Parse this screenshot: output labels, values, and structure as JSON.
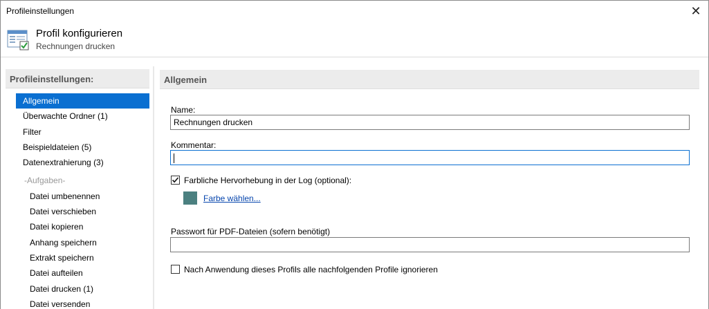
{
  "window": {
    "title": "Profileinstellungen"
  },
  "header": {
    "title": "Profil konfigurieren",
    "subtitle": "Rechnungen drucken"
  },
  "sidebar": {
    "heading": "Profileinstellungen:",
    "items": [
      {
        "label": "Allgemein",
        "selected": true
      },
      {
        "label": "Überwachte Ordner (1)"
      },
      {
        "label": "Filter"
      },
      {
        "label": "Beispieldateien (5)"
      },
      {
        "label": "Datenextrahierung (3)"
      }
    ],
    "group_label": "-Aufgaben-",
    "tasks": [
      "Datei umbenennen",
      "Datei verschieben",
      "Datei kopieren",
      "Anhang speichern",
      "Extrakt speichern",
      "Datei aufteilen",
      "Datei drucken (1)",
      "Datei versenden"
    ]
  },
  "content": {
    "heading": "Allgemein",
    "name_label": "Name:",
    "name_value": "Rechnungen drucken",
    "comment_label": "Kommentar:",
    "comment_value": "",
    "highlight_checkbox": {
      "label": "Farbliche Hervorhebung in der Log (optional):",
      "checked": true
    },
    "color_swatch": "#4b8080",
    "color_link": "Farbe wählen...",
    "password_label": "Passwort für PDF-Dateien (sofern benötigt)",
    "password_value": "",
    "ignore_checkbox": {
      "label": "Nach Anwendung dieses Profils alle nachfolgenden Profile ignorieren",
      "checked": false
    }
  },
  "colors": {
    "accent": "#0a6fd1",
    "link": "#0645ad"
  }
}
